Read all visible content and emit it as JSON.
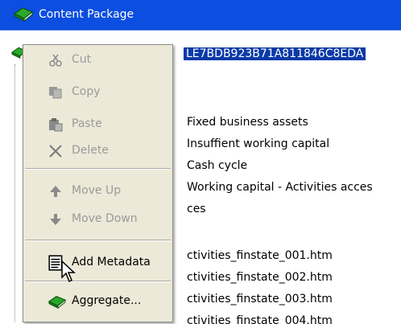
{
  "window": {
    "title": "Content Package"
  },
  "tree": {
    "selected_text": "LE7BDB923B71A811846C8EDA",
    "rows": [
      "Fixed business assets",
      "Insuffient working capital",
      "Cash cycle",
      "Working capital - Activities acces",
      "ces",
      "ctivities_finstate_001.htm",
      "ctivities_finstate_002.htm",
      "ctivities_finstate_003.htm",
      "ctivities_finstate_004.htm"
    ]
  },
  "context_menu": {
    "items": [
      {
        "label": "Cut",
        "icon": "scissors-icon",
        "enabled": false
      },
      {
        "label": "Copy",
        "icon": "copy-icon",
        "enabled": false
      },
      {
        "label": "Paste",
        "icon": "paste-icon",
        "enabled": false
      },
      {
        "label": "Delete",
        "icon": "delete-x-icon",
        "enabled": false
      },
      {
        "label": "Move Up",
        "icon": "arrow-up-icon",
        "enabled": false
      },
      {
        "label": "Move Down",
        "icon": "arrow-down-icon",
        "enabled": false
      },
      {
        "label": "Add Metadata",
        "icon": "metadata-document-icon",
        "enabled": true
      },
      {
        "label": "Aggregate...",
        "icon": "book-icon",
        "enabled": true
      }
    ]
  },
  "colors": {
    "title_bar": "#0b4ee0",
    "menu_bg": "#ece9d8",
    "selection": "#0a3aa8",
    "disabled_text": "#9a9a9a"
  }
}
